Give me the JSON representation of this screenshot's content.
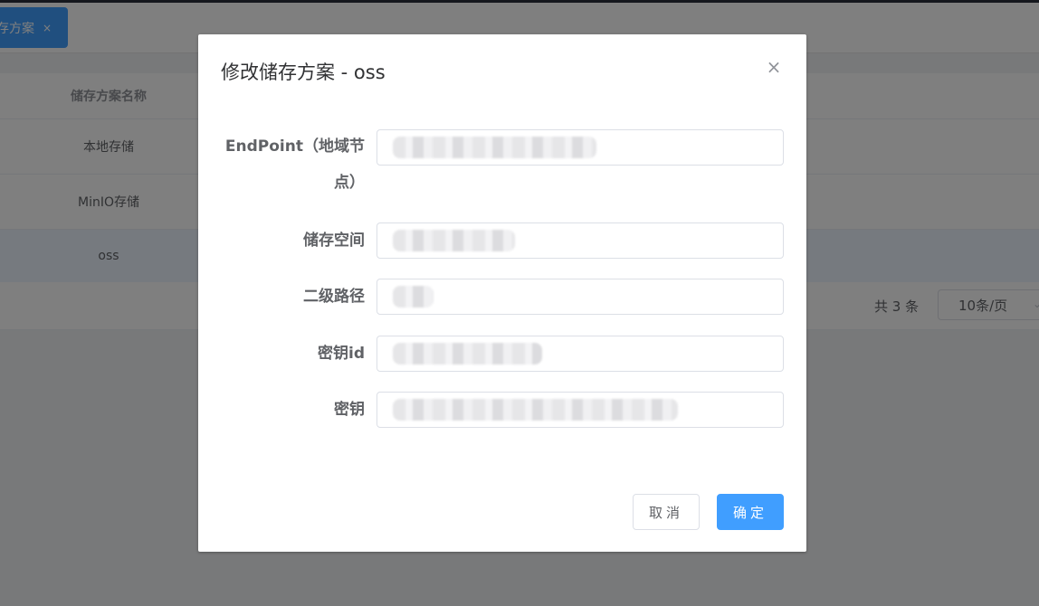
{
  "tabs": {
    "active_label": "存方案",
    "close_glyph": "×"
  },
  "table": {
    "header": "储存方案名称",
    "rows": [
      "本地存储",
      "MinIO存储",
      "oss"
    ],
    "selected_row": 2
  },
  "pagination": {
    "total": "共 3 条",
    "page_size": "10条/页"
  },
  "dialog": {
    "title": "修改储存方案 - oss",
    "close_glyph": "×",
    "fields": [
      {
        "label_line1": "EndPoint（地域节",
        "label_line2": "点）",
        "value": ""
      },
      {
        "label": "储存空间",
        "value": ""
      },
      {
        "label": "二级路径",
        "value": ""
      },
      {
        "label": "密钥id",
        "value": ""
      },
      {
        "label": "密钥",
        "value": ""
      }
    ],
    "cancel_label": "取消",
    "confirm_label": "确定"
  },
  "colors": {
    "primary": "#409eff",
    "mask": "rgba(0,0,0,0.5)"
  }
}
